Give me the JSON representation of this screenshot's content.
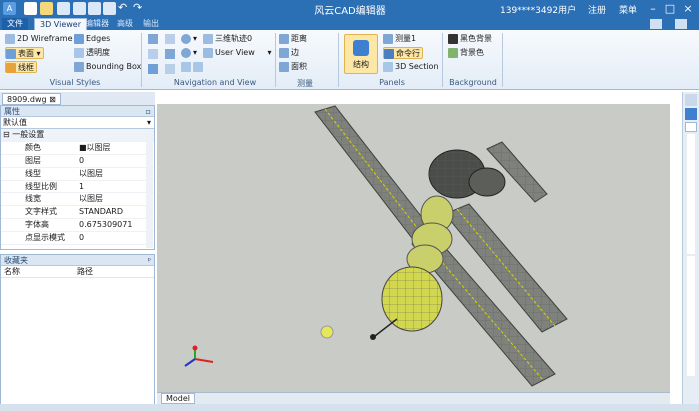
{
  "titlebar": {
    "title": "风云CAD编辑器",
    "user": "139****3492用户",
    "register": "注册",
    "menu": "菜单"
  },
  "tabs": [
    "文件",
    "3D Viewer",
    "编辑器",
    "高级",
    "输出"
  ],
  "ribbon": {
    "visual_styles": {
      "wireframe": "2D Wireframe",
      "edges": "Edges",
      "surface": "表面",
      "transparent": "透明度",
      "wire": "线框",
      "bounding": "Bounding Box",
      "title": "Visual Styles"
    },
    "nav": {
      "orbit": "三维轨迹0",
      "user_view": "User View",
      "title": "Navigation and View"
    },
    "measure": {
      "distance": "距离",
      "edge": "边",
      "area": "面积",
      "title": "测量"
    },
    "panels": {
      "structure": "结构",
      "measure1": "测量1",
      "cmdline": "命令行",
      "section": "3D Section",
      "title": "Panels"
    },
    "background": {
      "black": "黑色背景",
      "bg": "背景色",
      "title": "Background"
    }
  },
  "doc_tab": "8909.dwg",
  "props": {
    "title": "属性",
    "filter": "默认值",
    "section": "一般设置",
    "rows": [
      {
        "k": "颜色",
        "v": "■以图层"
      },
      {
        "k": "图层",
        "v": "0"
      },
      {
        "k": "线型",
        "v": "以图层"
      },
      {
        "k": "线型比例",
        "v": "1"
      },
      {
        "k": "线宽",
        "v": "以图层"
      },
      {
        "k": "文字样式",
        "v": "STANDARD"
      },
      {
        "k": "字体高",
        "v": "0.675309071"
      },
      {
        "k": "点显示模式",
        "v": "0"
      }
    ]
  },
  "favorites": {
    "title": "收藏夹",
    "col1": "名称",
    "col2": "路径"
  },
  "model_tab": "Model"
}
